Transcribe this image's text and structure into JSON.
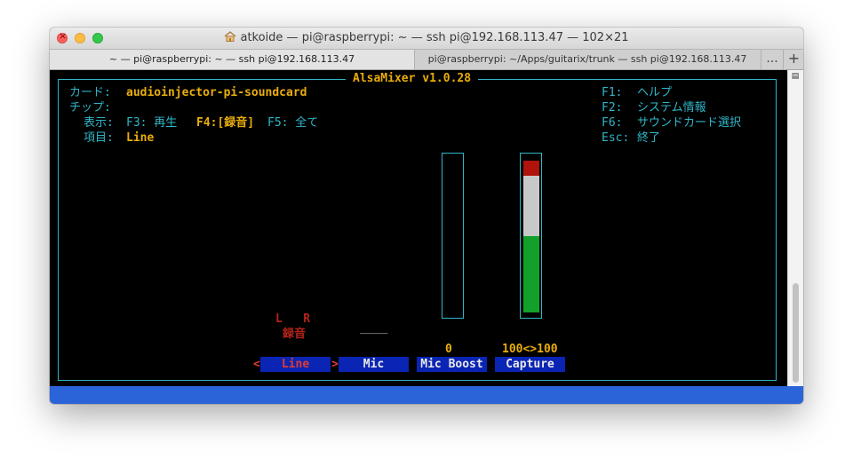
{
  "window": {
    "title": "atkoide — pi@raspberrypi: ~ — ssh pi@192.168.113.47 — 102×21",
    "tabs": [
      {
        "label": "~ — pi@raspberrypi: ~ — ssh pi@192.168.113.47"
      },
      {
        "label": "pi@raspberrypi: ~/Apps/guitarix/trunk — ssh pi@192.168.113.47"
      }
    ],
    "tab_overflow": "...",
    "new_tab": "+"
  },
  "mixer": {
    "title": "AlsaMixer v1.0.28",
    "card_label": "カード:",
    "card_value": "audioinjector-pi-soundcard",
    "chip_label": "チップ:",
    "chip_value": "",
    "view_label": "表示:",
    "view_f3": "F3: 再生",
    "view_f4": "F4:[録音]",
    "view_f5": "F5: 全て",
    "item_label": "項目:",
    "item_value": "Line",
    "help": [
      {
        "key": "F1:",
        "text": "ヘルプ"
      },
      {
        "key": "F2:",
        "text": "システム情報"
      },
      {
        "key": "F6:",
        "text": "サウンドカード選択"
      },
      {
        "key": "Esc:",
        "text": "終了"
      }
    ]
  },
  "controls": {
    "line": {
      "left_marker": "<",
      "name": "Line",
      "right_marker": ">",
      "channels": "L   R",
      "capture_label": "録音"
    },
    "mic": {
      "name": "Mic",
      "dashes": "____"
    },
    "mic_boost": {
      "name": "Mic Boost",
      "value": "0",
      "level": 0
    },
    "capture": {
      "name": "Capture",
      "value": "100<>100",
      "level": 1.0
    }
  },
  "colors": {
    "terminal_bg": "#000000",
    "cyan": "#2fb6c8",
    "yellow": "#e9ad0c",
    "red": "#b3231a",
    "label_bar": "#0a24b4",
    "meter_green": "#12a02a",
    "meter_white": "#c8c8c8",
    "meter_red": "#b0120c"
  },
  "icons": {
    "title_icon": "home-icon",
    "scroll_icon": "scrollbar-menu-icon"
  }
}
